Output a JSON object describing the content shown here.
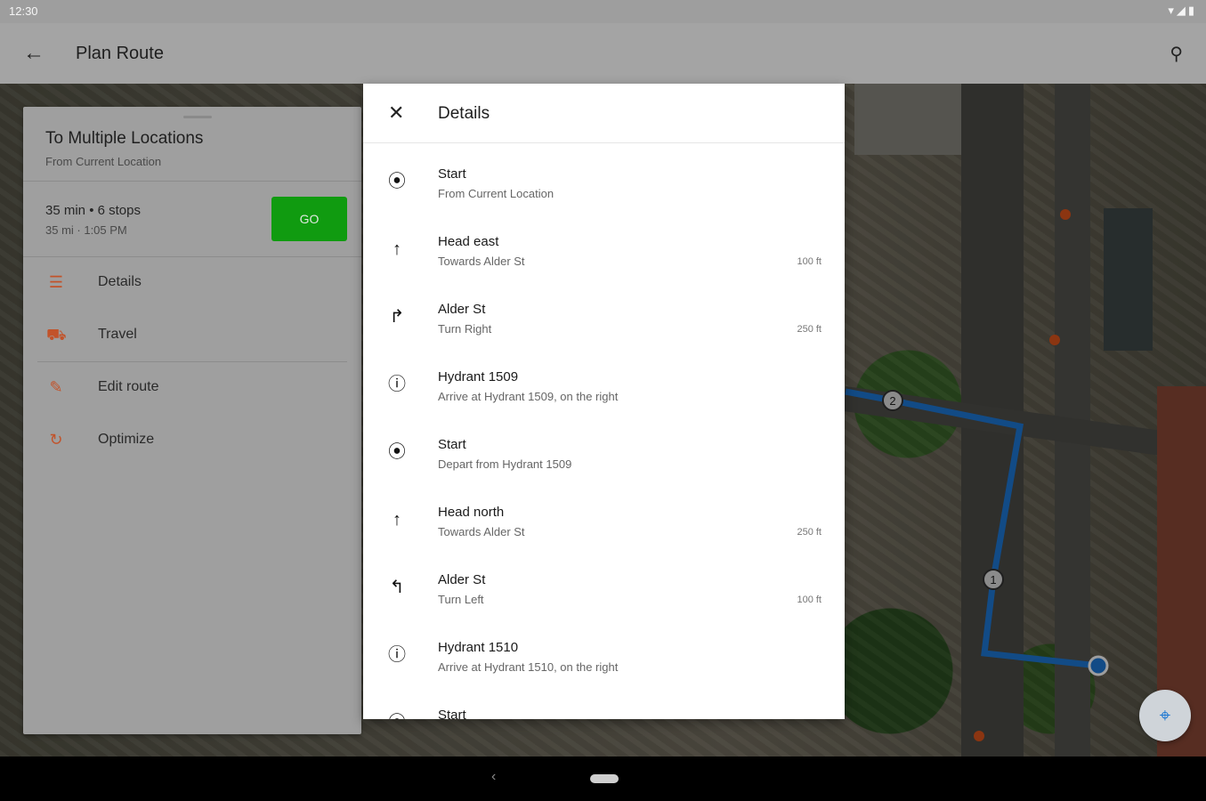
{
  "status": {
    "time": "12:30",
    "icons": "▾◢▮"
  },
  "appbar": {
    "back_icon": "←",
    "title": "Plan Route",
    "search_icon": "⚲"
  },
  "route": {
    "title": "To Multiple Locations",
    "subtitle": "From Current Location",
    "summary": "35 min  •  6 stops",
    "eta": "35 mi · 1:05 PM",
    "go_label": "GO",
    "menu": [
      {
        "icon": "☰",
        "label": "Details"
      },
      {
        "icon": "⛟",
        "label": "Travel"
      },
      {
        "icon": "✎",
        "label": "Edit route"
      },
      {
        "icon": "↻",
        "label": "Optimize"
      }
    ]
  },
  "details": {
    "close_icon": "✕",
    "title": "Details",
    "steps": [
      {
        "icon": "⦿",
        "title": "Start",
        "subtitle": "From Current Location",
        "distance": ""
      },
      {
        "icon": "↑",
        "title": "Head east",
        "subtitle": "Towards Alder St",
        "distance": "100 ft"
      },
      {
        "icon": "↱",
        "title": "Alder St",
        "subtitle": "Turn Right",
        "distance": "250 ft"
      },
      {
        "icon": "ⓘ",
        "title": "Hydrant 1509",
        "subtitle": "Arrive at Hydrant 1509, on the right",
        "distance": ""
      },
      {
        "icon": "⦿",
        "title": "Start",
        "subtitle": "Depart from Hydrant 1509",
        "distance": ""
      },
      {
        "icon": "↑",
        "title": "Head north",
        "subtitle": "Towards Alder St",
        "distance": "250 ft"
      },
      {
        "icon": "↰",
        "title": "Alder St",
        "subtitle": "Turn Left",
        "distance": "100 ft"
      },
      {
        "icon": "ⓘ",
        "title": "Hydrant 1510",
        "subtitle": "Arrive at Hydrant 1510, on the right",
        "distance": ""
      },
      {
        "icon": "⦿",
        "title": "Start",
        "subtitle": "",
        "distance": ""
      }
    ]
  },
  "map": {
    "route_color": "#1e7ad8",
    "stop_labels": [
      "2",
      "1"
    ],
    "locate_icon": "⌖"
  },
  "navbar": {
    "back_icon": "‹"
  }
}
